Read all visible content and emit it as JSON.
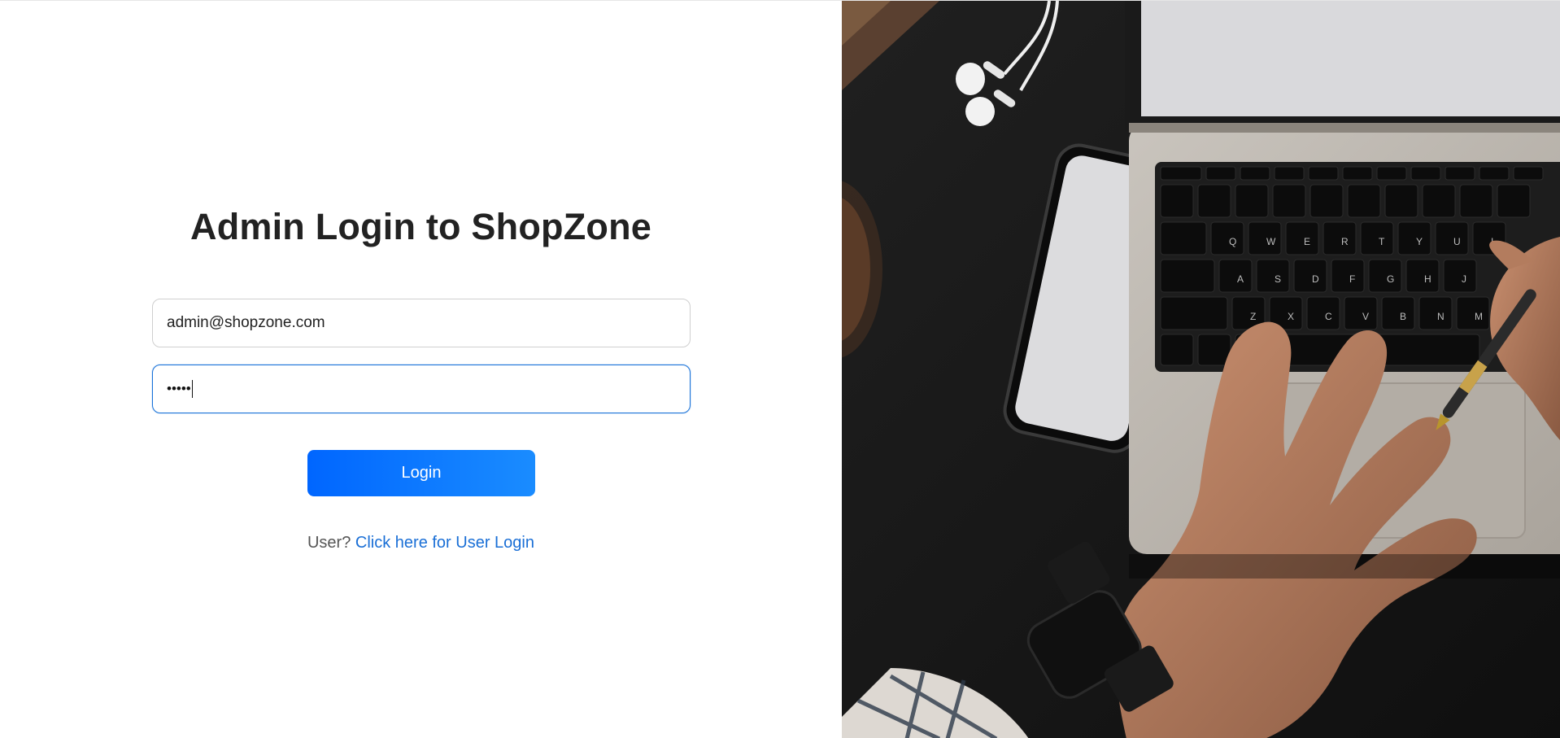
{
  "login_form": {
    "title": "Admin Login to ShopZone",
    "email_value": "admin@shopzone.com",
    "password_masked": "•••••",
    "login_label": "Login",
    "user_prompt": "User?",
    "user_link_label": "Click here for User Login"
  },
  "hero_image": {
    "icon": "laptop-desk-photo",
    "keyboard_letters_row1": [
      "Q",
      "W",
      "E",
      "R",
      "T",
      "Y",
      "U",
      "I"
    ],
    "keyboard_letters_row2": [
      "A",
      "S",
      "D",
      "F",
      "G",
      "H",
      "J"
    ],
    "keyboard_letters_row3": [
      "Z",
      "X",
      "C",
      "V",
      "B",
      "N",
      "M"
    ]
  },
  "colors": {
    "accent": "#0066ff",
    "link": "#1a6fd6",
    "focus_border": "#1a73d9",
    "title": "#222222"
  }
}
